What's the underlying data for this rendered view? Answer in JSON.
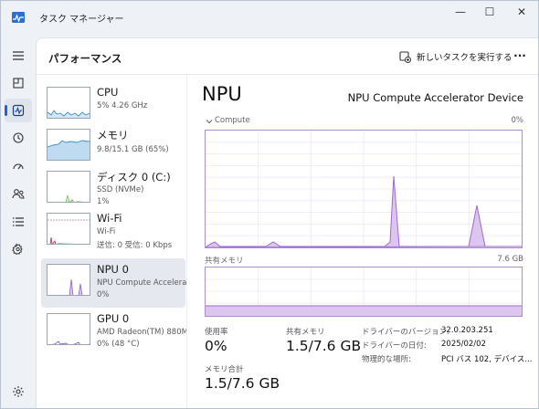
{
  "window": {
    "title": "タスク マネージャー",
    "minimize": "—",
    "maximize": "☐",
    "close": "✕"
  },
  "header": {
    "title": "パフォーマンス",
    "run_task": "新しいタスクを実行する",
    "more": "···"
  },
  "nav": [
    "menu-icon",
    "processes-icon",
    "performance-icon",
    "app-history-icon",
    "startup-apps-icon",
    "users-icon",
    "details-icon",
    "services-icon"
  ],
  "devices": [
    {
      "name": "CPU",
      "line1": "5%  4.26 GHz",
      "line2": ""
    },
    {
      "name": "メモリ",
      "line1": "9.8/15.1 GB (65%)",
      "line2": ""
    },
    {
      "name": "ディスク 0 (C:)",
      "line1": "SSD (NVMe)",
      "line2": "1%"
    },
    {
      "name": "Wi-Fi",
      "line1": "Wi-Fi",
      "line2": "送信: 0  受信: 0 Kbps"
    },
    {
      "name": "NPU 0",
      "line1": "NPU Compute Accelerator Device",
      "line2": "0%"
    },
    {
      "name": "GPU 0",
      "line1": "AMD Radeon(TM) 880M",
      "line2": "0%  (48 °C)"
    }
  ],
  "detail": {
    "title": "NPU",
    "device": "NPU Compute Accelerator Device",
    "compute_label": "Compute",
    "compute_max": "0%",
    "shared_mem_label": "共有メモリ",
    "shared_mem_max": "7.6 GB",
    "usage_label": "使用率",
    "usage_value": "0%",
    "shared_label": "共有メモリ",
    "shared_value": "1.5/7.6 GB",
    "mem_total_label": "メモリ合計",
    "mem_total_value": "1.5/7.6 GB",
    "info": [
      {
        "label": "ドライバーのバージョン:",
        "value": "32.0.203.251"
      },
      {
        "label": "ドライバーの日付:",
        "value": "2025/02/02"
      },
      {
        "label": "物理的な場所:",
        "value": "PCI バス 102, デバイス..."
      }
    ]
  },
  "colors": {
    "accent": "#2463c8",
    "npu": "#a06ad0",
    "npu_fill": "#dcc6f0",
    "cpu": "#3a8fc4",
    "disk": "#5fae3b",
    "wifi": "#b53a5a",
    "gpu": "#8a5bc4"
  }
}
